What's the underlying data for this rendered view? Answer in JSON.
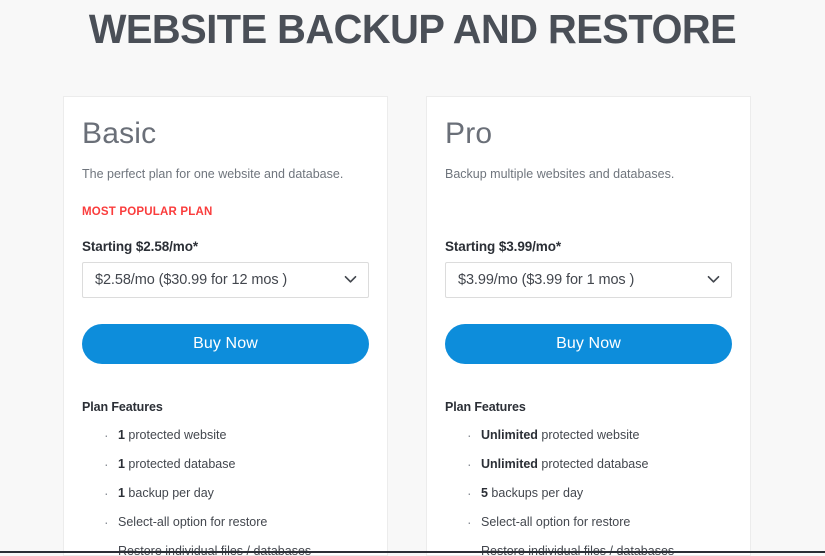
{
  "header": {
    "title": "WEBSITE BACKUP AND RESTORE"
  },
  "colors": {
    "title": "#4a4f57",
    "accent_button": "#0d8ddb",
    "badge_red": "#fa3c3c",
    "page_background": "#f8f8f8",
    "card_background": "#ffffff"
  },
  "cards": [
    {
      "name": "Basic",
      "description": "The perfect plan for one website and database.",
      "badge": "MOST POPULAR PLAN",
      "starting": "Starting $2.58/mo*",
      "select_value": "$2.58/mo ($30.99 for 12 mos )",
      "buy_label": "Buy Now",
      "features_title": "Plan Features",
      "features": [
        {
          "emphasis": "1",
          "text": " protected website"
        },
        {
          "emphasis": "1",
          "text": " protected database"
        },
        {
          "emphasis": "1",
          "text": " backup per day"
        },
        {
          "emphasis": "",
          "text": "Select-all option for restore"
        },
        {
          "emphasis": "",
          "text": "Restore individual files / databases"
        }
      ]
    },
    {
      "name": "Pro",
      "description": "Backup multiple websites and databases.",
      "badge": "",
      "starting": "Starting $3.99/mo*",
      "select_value": "$3.99/mo ($3.99 for 1 mos )",
      "buy_label": "Buy Now",
      "features_title": "Plan Features",
      "features": [
        {
          "emphasis": "Unlimited",
          "text": " protected website"
        },
        {
          "emphasis": "Unlimited",
          "text": " protected database"
        },
        {
          "emphasis": "5",
          "text": " backups per day"
        },
        {
          "emphasis": "",
          "text": "Select-all option for restore"
        },
        {
          "emphasis": "",
          "text": "Restore individual files / databases"
        }
      ]
    }
  ]
}
